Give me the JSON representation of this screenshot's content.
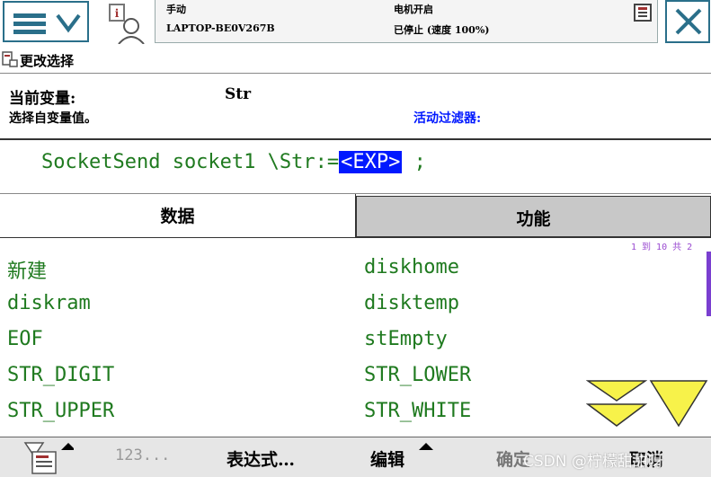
{
  "topbar": {
    "mode_label": "手动",
    "device_name": "LAPTOP-BE0V267B",
    "motor_status": "电机开启",
    "run_status": "已停止 (速度 100%)"
  },
  "screen_title": "更改选择",
  "info": {
    "current_var_label": "当前变量:",
    "current_var_value": "Str",
    "select_hint": "选择自变量值。",
    "filter_label": "活动过滤器:"
  },
  "expression": {
    "prefix": "SocketSend socket1 \\Str:=",
    "placeholder": "<EXP>",
    "suffix": " ;"
  },
  "tabs": {
    "data": "数据",
    "function": "功能"
  },
  "list": {
    "page_indicator": "1 到 10 共 2",
    "items": [
      "新建",
      "diskhome",
      "diskram",
      "disktemp",
      "EOF",
      "stEmpty",
      "STR_DIGIT",
      "STR_LOWER",
      "STR_UPPER",
      "STR_WHITE"
    ]
  },
  "bottombar": {
    "num_label": "123...",
    "expr_label": "表达式…",
    "edit_label": "编辑",
    "ok_label": "确定",
    "cancel_label": "取消"
  },
  "watermark": "CSDN @柠檬甜甜呀",
  "colors": {
    "accent": "#2a6f8a",
    "list_text": "#1f7a1f",
    "highlight": "#0018ff",
    "filter_text": "#0018ff",
    "scroll_arrow": "#f7f24a"
  }
}
